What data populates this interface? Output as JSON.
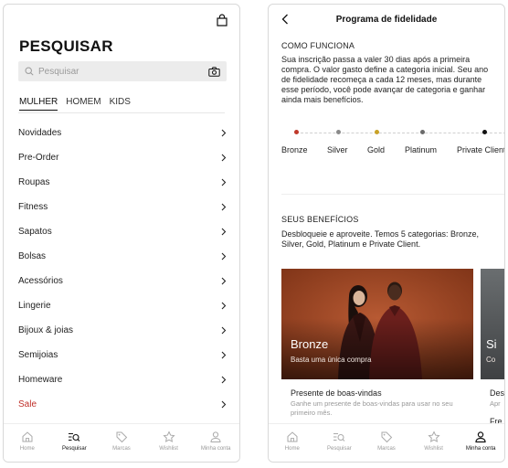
{
  "left": {
    "title": "PESQUISAR",
    "search_placeholder": "Pesquisar",
    "tabs": [
      "MULHER",
      "HOMEM",
      "KIDS"
    ],
    "active_tab": "MULHER",
    "categories": [
      "Novidades",
      "Pre-Order",
      "Roupas",
      "Fitness",
      "Sapatos",
      "Bolsas",
      "Acessórios",
      "Lingerie",
      "Bijoux & joias",
      "Semijoias",
      "Homeware",
      "Sale"
    ],
    "sale_color": "#c0302a",
    "nav": [
      {
        "label": "Home",
        "icon": "home-icon"
      },
      {
        "label": "Pesquisar",
        "icon": "search-icon"
      },
      {
        "label": "Marcas",
        "icon": "tag-icon"
      },
      {
        "label": "Wishlist",
        "icon": "star-icon"
      },
      {
        "label": "Minha conta",
        "icon": "user-icon"
      }
    ],
    "active_nav": "Pesquisar"
  },
  "right": {
    "title": "Programa de fidelidade",
    "how_label": "COMO FUNCIONA",
    "how_text": "Sua inscrição passa a valer 30 dias após a primeira compra. O valor gasto define a categoria inicial. Seu ano de fidelidade recomeça a cada 12 meses, mas durante esse período, você pode avançar de categoria e ganhar ainda mais benefícios.",
    "tiers": [
      {
        "name": "Bronze",
        "color": "#c0392b"
      },
      {
        "name": "Silver",
        "color": "#8a8a8a"
      },
      {
        "name": "Gold",
        "color": "#c9a227"
      },
      {
        "name": "Platinum",
        "color": "#6b6b6b"
      },
      {
        "name": "Private Client",
        "color": "#111111"
      }
    ],
    "benefits_label": "SEUS BENEFÍCIOS",
    "benefits_text": "Desbloqueie e aproveite. Temos 5 categorias: Bronze, Silver, Gold, Platinum e Private Client.",
    "cards": [
      {
        "tier": "Bronze",
        "subtitle": "Basta uma única compra",
        "benefit_title": "Presente de boas-vindas",
        "benefit_desc": "Ganhe um presente de boas-vindas para usar no seu primeiro mês."
      },
      {
        "tier": "Si",
        "subtitle": "Co",
        "benefit_title": "Des",
        "benefit_desc": "Apr",
        "extra": "Fre"
      }
    ],
    "nav": [
      {
        "label": "Home",
        "icon": "home-icon"
      },
      {
        "label": "Pesquisar",
        "icon": "search-icon"
      },
      {
        "label": "Marcas",
        "icon": "tag-icon"
      },
      {
        "label": "Wishlist",
        "icon": "star-icon"
      },
      {
        "label": "Minha conta",
        "icon": "user-icon"
      }
    ],
    "active_nav": "Minha conta"
  }
}
